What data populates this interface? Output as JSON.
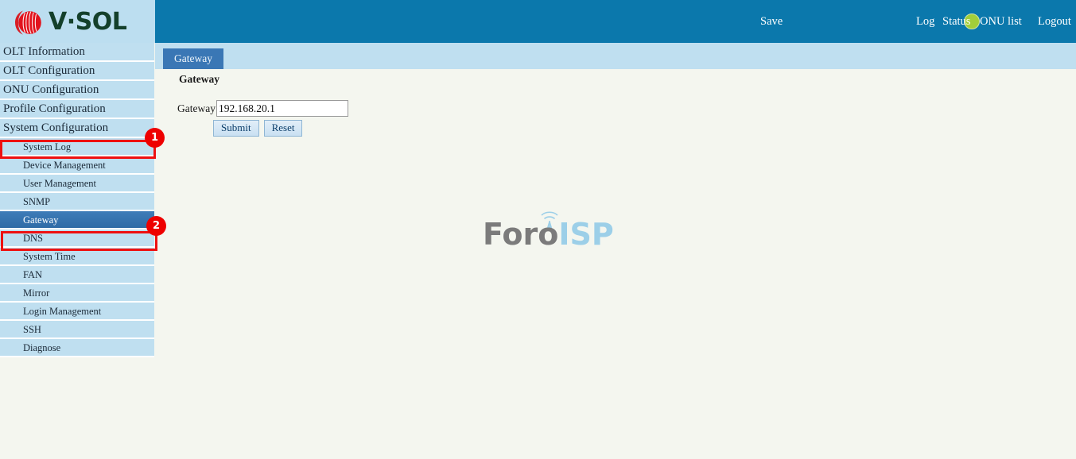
{
  "brand": {
    "logo_text": "V·SOL",
    "logo_mark": "vsol-sphere-icon",
    "accent_red": "#d81f26"
  },
  "header": {
    "background": "#0b78ac",
    "save_label": "Save",
    "status_indicator": {
      "name": "status-dot",
      "color": "#a2ce3a"
    },
    "links": [
      {
        "label": "Log"
      },
      {
        "label": "Status"
      },
      {
        "label": "ONU list"
      },
      {
        "label": "Logout"
      }
    ]
  },
  "tabs": [
    {
      "label": "Gateway",
      "active": true
    }
  ],
  "sidebar": {
    "background": "#bfdff0",
    "selected_color": "#3a77b5",
    "items": [
      {
        "label": "OLT Information",
        "level": "top",
        "selected": false
      },
      {
        "label": "OLT Configuration",
        "level": "top",
        "selected": false
      },
      {
        "label": "ONU Configuration",
        "level": "top",
        "selected": false
      },
      {
        "label": "Profile Configuration",
        "level": "top",
        "selected": false
      },
      {
        "label": "System Configuration",
        "level": "top",
        "selected": false
      },
      {
        "label": "System Log",
        "level": "sub",
        "selected": false
      },
      {
        "label": "Device Management",
        "level": "sub",
        "selected": false
      },
      {
        "label": "User Management",
        "level": "sub",
        "selected": false
      },
      {
        "label": "SNMP",
        "level": "sub",
        "selected": false
      },
      {
        "label": "Gateway",
        "level": "sub",
        "selected": true
      },
      {
        "label": "DNS",
        "level": "sub",
        "selected": false
      },
      {
        "label": "System Time",
        "level": "sub",
        "selected": false
      },
      {
        "label": "FAN",
        "level": "sub",
        "selected": false
      },
      {
        "label": "Mirror",
        "level": "sub",
        "selected": false
      },
      {
        "label": "Login Management",
        "level": "sub",
        "selected": false
      },
      {
        "label": "SSH",
        "level": "sub",
        "selected": false
      },
      {
        "label": "Diagnose",
        "level": "sub",
        "selected": false
      }
    ]
  },
  "main": {
    "section_title": "Gateway",
    "gateway_field": {
      "label": "Gateway",
      "value": "192.168.20.1",
      "placeholder": ""
    },
    "submit_label": "Submit",
    "reset_label": "Reset"
  },
  "watermark": {
    "text_part1": "Foro",
    "text_part2": "ISP",
    "color1": "#7b7b7b",
    "color2": "#9ccfe8",
    "icon": "antenna-tower-icon"
  },
  "annotations": [
    {
      "number": "1",
      "target": "System Configuration",
      "color": "#ee0000"
    },
    {
      "number": "2",
      "target": "Gateway",
      "color": "#ee0000"
    }
  ]
}
